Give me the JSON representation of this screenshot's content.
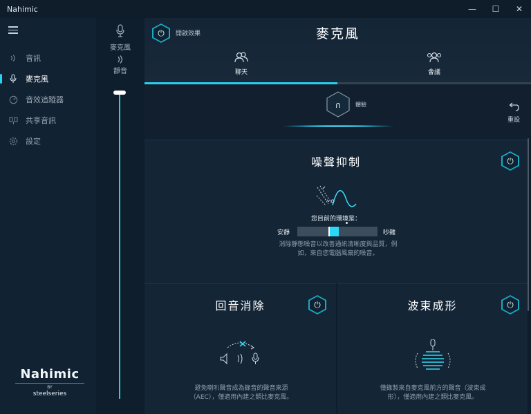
{
  "window": {
    "title": "Nahimic",
    "minimize": "—",
    "maximize": "☐",
    "close": "✕"
  },
  "sidebar": {
    "items": [
      {
        "label": "音訊",
        "icon": "speaker-wave-icon"
      },
      {
        "label": "麥克風",
        "icon": "microphone-icon"
      },
      {
        "label": "音效追蹤器",
        "icon": "sound-tracker-icon"
      },
      {
        "label": "共享音訊",
        "icon": "share-audio-icon"
      },
      {
        "label": "設定",
        "icon": "gear-icon"
      }
    ],
    "active_index": 1,
    "brand": {
      "name": "Nahimic",
      "by": "BY",
      "partner": "steelseries"
    }
  },
  "volume": {
    "mic_label": "麥克風",
    "mute_label": "靜音",
    "level": 1.0
  },
  "header": {
    "enable_label": "開啟效果",
    "title": "麥克風"
  },
  "tabs": [
    {
      "label": "聊天",
      "icon": "chat-users-icon"
    },
    {
      "label": "會議",
      "icon": "meeting-users-icon"
    }
  ],
  "preset": {
    "label": "體驗",
    "reset_label": "重設"
  },
  "noise_suppression": {
    "title": "噪聲抑制",
    "env_label": "您目前的環境是：",
    "quiet_label": "安靜",
    "noisy_label": "吵雜",
    "level": 0.45,
    "description": "消除靜態噪音以改善通訊清晰度與品質，例如，來自您電腦風扇的噪音。"
  },
  "echo_cancel": {
    "title": "回音消除",
    "description": "避免喇叭聲音成為錄音的聲音來源（AEC），僅適用內建之類比麥克風。"
  },
  "beamforming": {
    "title": "波束成形",
    "description": "僅錄製來自麥克風前方的聲音（波束成形），僅適用內建之類比麥克風。"
  },
  "colors": {
    "accent": "#2bd3f2",
    "background": "#0d1a26"
  }
}
